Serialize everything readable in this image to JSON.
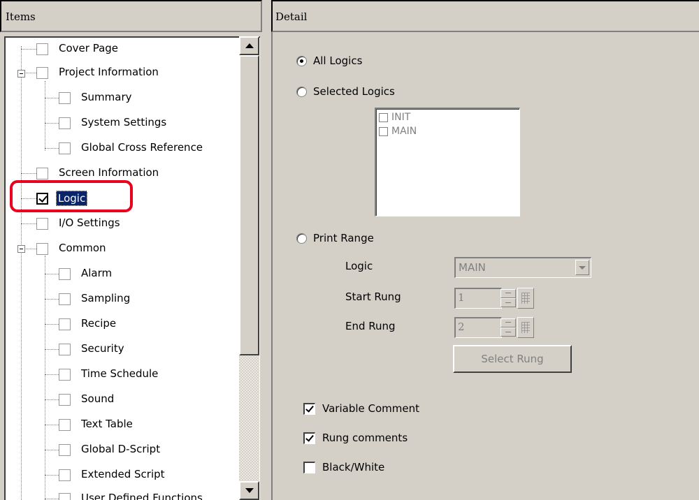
{
  "left_panel": {
    "title": "Items",
    "tree": [
      {
        "label": "Cover Page",
        "checked": false
      },
      {
        "label": "Project Information",
        "checked": false
      },
      {
        "label": "Summary",
        "checked": false
      },
      {
        "label": "System Settings",
        "checked": false
      },
      {
        "label": "Global Cross Reference",
        "checked": false
      },
      {
        "label": "Screen Information",
        "checked": false
      },
      {
        "label": "Logic",
        "checked": true,
        "selected": true
      },
      {
        "label": "I/O Settings",
        "checked": false
      },
      {
        "label": "Common",
        "checked": false
      },
      {
        "label": "Alarm",
        "checked": false
      },
      {
        "label": "Sampling",
        "checked": false
      },
      {
        "label": "Recipe",
        "checked": false
      },
      {
        "label": "Security",
        "checked": false
      },
      {
        "label": "Time Schedule",
        "checked": false
      },
      {
        "label": "Sound",
        "checked": false
      },
      {
        "label": "Text Table",
        "checked": false
      },
      {
        "label": "Global D-Script",
        "checked": false
      },
      {
        "label": "Extended Script",
        "checked": false
      },
      {
        "label": "User Defined Functions",
        "checked": false
      }
    ]
  },
  "right_panel": {
    "title": "Detail",
    "radio_all_logics": "All Logics",
    "radio_selected_logics": "Selected Logics",
    "logic_list": [
      "INIT",
      "MAIN"
    ],
    "radio_print_range": "Print Range",
    "logic_label": "Logic",
    "logic_value": "MAIN",
    "start_rung_label": "Start Rung",
    "start_rung_value": "1",
    "end_rung_label": "End Rung",
    "end_rung_value": "2",
    "select_rung_button": "Select Rung",
    "variable_comment_label": "Variable Comment",
    "variable_comment_checked": true,
    "rung_comments_label": "Rung comments",
    "rung_comments_checked": true,
    "black_white_label": "Black/White",
    "black_white_checked": false
  },
  "colors": {
    "panel_bg": "#d4d0c8",
    "selection_bg": "#0a246a",
    "highlight_border": "#e8001c",
    "disabled_text": "#808080"
  },
  "icons": [
    "checkbox-icon",
    "expander-minus-icon",
    "radio-icon",
    "dropdown-arrow-icon",
    "spin-icon",
    "grid-icon",
    "scroll-up-icon",
    "scroll-down-icon"
  ]
}
